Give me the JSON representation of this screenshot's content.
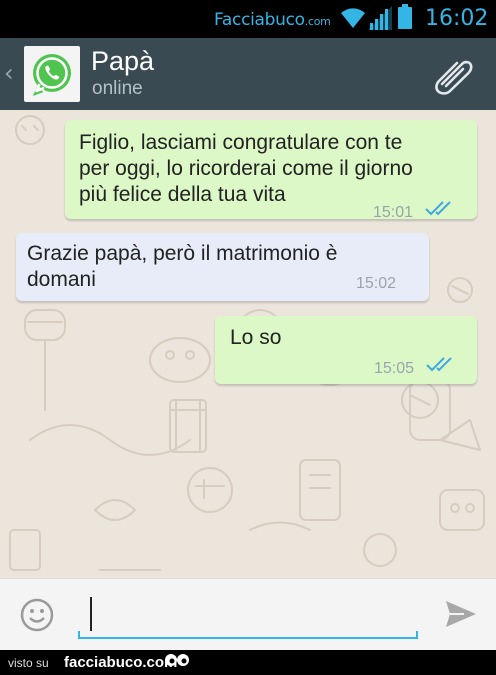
{
  "status_bar": {
    "carrier_name": "Facciabuco",
    "carrier_suffix": ".com",
    "time": "16:02"
  },
  "header": {
    "back_glyph": "‹",
    "contact_name": "Papà",
    "contact_status": "online",
    "avatar_icon": "whatsapp-logo",
    "attach_icon": "paperclip-icon"
  },
  "messages": [
    {
      "direction": "outgoing",
      "lines": [
        "Figlio, lasciami congratulare con te",
        "per oggi, lo ricorderai come il giorno",
        "più felice della tua vita"
      ],
      "time": "15:01",
      "read": true
    },
    {
      "direction": "incoming",
      "lines": [
        "Grazie papà, però il matrimonio è",
        "domani"
      ],
      "time": "15:02"
    },
    {
      "direction": "outgoing",
      "lines": [
        "Lo so"
      ],
      "time": "15:05",
      "read": true
    }
  ],
  "input": {
    "value": "",
    "emoji_icon": "smiley-icon",
    "send_icon": "send-icon"
  },
  "footer": {
    "visto_label": "visto su",
    "brand": "facciabuco.com"
  },
  "colors": {
    "accent": "#33b5e5",
    "outgoing_bubble": "#dcf8c6",
    "incoming_bubble": "#e8ecf8",
    "header": "#3a4a53",
    "read_ticks": "#3fa9e0"
  }
}
